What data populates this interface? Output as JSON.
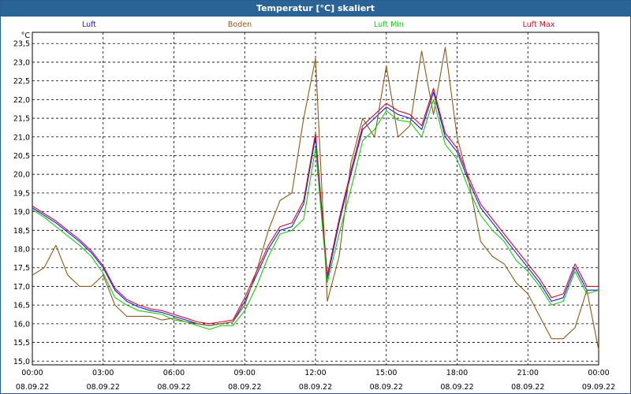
{
  "window": {
    "title": "Temperatur [°C] skaliert"
  },
  "chart_data": {
    "type": "line",
    "title": "Temperatur [°C] skaliert",
    "ylabel": "°C",
    "ylim": [
      14.9,
      23.8
    ],
    "xlim": [
      0,
      24
    ],
    "grid": true,
    "legend": "top",
    "yticks": [
      "23,5",
      "23,0",
      "22,5",
      "22,0",
      "21,5",
      "21,0",
      "20,5",
      "20,0",
      "19,5",
      "19,0",
      "18,5",
      "18,0",
      "17,5",
      "17,0",
      "16,5",
      "16,0",
      "15,5",
      "15,0"
    ],
    "xticks": [
      {
        "t": 0,
        "time": "00:00",
        "date": "08.09.22"
      },
      {
        "t": 3,
        "time": "03:00",
        "date": "08.09.22"
      },
      {
        "t": 6,
        "time": "06:00",
        "date": "08.09.22"
      },
      {
        "t": 9,
        "time": "09:00",
        "date": "08.09.22"
      },
      {
        "t": 12,
        "time": "12:00",
        "date": "08.09.22"
      },
      {
        "t": 15,
        "time": "15:00",
        "date": "08.09.22"
      },
      {
        "t": 18,
        "time": "18:00",
        "date": "08.09.22"
      },
      {
        "t": 21,
        "time": "21:00",
        "date": "08.09.22"
      },
      {
        "t": 24,
        "time": "00:00",
        "date": "09.09.22"
      }
    ],
    "series": [
      {
        "name": "Luft",
        "color": "#1a1adc",
        "x": [
          0,
          0.5,
          1,
          1.5,
          2,
          2.5,
          3,
          3.5,
          4,
          4.5,
          5,
          5.5,
          6,
          6.5,
          7,
          7.5,
          8,
          8.5,
          9,
          9.5,
          10,
          10.5,
          11,
          11.5,
          12,
          12.5,
          13,
          13.5,
          14,
          14.5,
          15,
          15.5,
          16,
          16.5,
          17,
          17.5,
          18,
          18.5,
          19,
          19.5,
          20,
          20.5,
          21,
          21.5,
          22,
          22.5,
          23,
          23.5,
          24
        ],
        "y": [
          19.1,
          18.9,
          18.7,
          18.45,
          18.2,
          17.9,
          17.5,
          16.9,
          16.6,
          16.45,
          16.35,
          16.3,
          16.2,
          16.1,
          16.0,
          15.95,
          16.0,
          16.05,
          16.6,
          17.3,
          18.0,
          18.5,
          18.6,
          19.2,
          21.0,
          17.2,
          18.7,
          20.0,
          21.2,
          21.5,
          21.8,
          21.6,
          21.5,
          21.2,
          22.2,
          21.0,
          20.6,
          19.8,
          19.1,
          18.7,
          18.3,
          17.9,
          17.5,
          17.1,
          16.6,
          16.7,
          17.5,
          16.9,
          16.9
        ]
      },
      {
        "name": "Boden",
        "color": "#8a5a1a",
        "x": [
          0,
          0.5,
          1,
          1.5,
          2,
          2.5,
          3,
          3.5,
          4,
          4.5,
          5,
          5.5,
          6,
          6.5,
          7,
          7.5,
          8,
          8.5,
          9,
          9.5,
          10,
          10.5,
          11,
          11.5,
          12,
          12.5,
          13,
          13.5,
          14,
          14.5,
          15,
          15.5,
          16,
          16.5,
          17,
          17.5,
          18,
          18.5,
          19,
          19.5,
          20,
          20.5,
          21,
          21.5,
          22,
          22.5,
          23,
          23.5,
          24
        ],
        "y": [
          17.3,
          17.5,
          18.1,
          17.3,
          17.0,
          17.0,
          17.3,
          16.5,
          16.2,
          16.2,
          16.2,
          16.1,
          16.15,
          16.05,
          16.0,
          15.95,
          16.0,
          16.05,
          16.5,
          17.4,
          18.5,
          19.3,
          19.5,
          21.5,
          23.1,
          16.6,
          17.8,
          20.3,
          21.5,
          21.0,
          22.9,
          21.0,
          21.3,
          23.3,
          21.6,
          23.4,
          21.0,
          19.8,
          18.2,
          17.8,
          17.6,
          17.1,
          16.8,
          16.2,
          15.6,
          15.6,
          15.9,
          16.9,
          15.3
        ]
      },
      {
        "name": "Luft Min",
        "color": "#18c818",
        "x": [
          0,
          0.5,
          1,
          1.5,
          2,
          2.5,
          3,
          3.5,
          4,
          4.5,
          5,
          5.5,
          6,
          6.5,
          7,
          7.5,
          8,
          8.5,
          9,
          9.5,
          10,
          10.5,
          11,
          11.5,
          12,
          12.5,
          13,
          13.5,
          14,
          14.5,
          15,
          15.5,
          16,
          16.5,
          17,
          17.5,
          18,
          18.5,
          19,
          19.5,
          20,
          20.5,
          21,
          21.5,
          22,
          22.5,
          23,
          23.5,
          24
        ],
        "y": [
          19.05,
          18.85,
          18.6,
          18.35,
          18.1,
          17.8,
          17.35,
          16.7,
          16.5,
          16.35,
          16.3,
          16.25,
          16.1,
          16.05,
          15.95,
          15.85,
          15.95,
          15.95,
          16.35,
          17.0,
          17.8,
          18.4,
          18.5,
          18.8,
          20.7,
          17.1,
          18.4,
          19.6,
          20.9,
          21.2,
          21.7,
          21.45,
          21.4,
          21.0,
          22.0,
          20.8,
          20.4,
          19.6,
          18.9,
          18.5,
          18.2,
          17.7,
          17.4,
          17.0,
          16.5,
          16.6,
          17.4,
          16.8,
          16.9
        ]
      },
      {
        "name": "Luft Max",
        "color": "#c8102e",
        "x": [
          0,
          0.5,
          1,
          1.5,
          2,
          2.5,
          3,
          3.5,
          4,
          4.5,
          5,
          5.5,
          6,
          6.5,
          7,
          7.5,
          8,
          8.5,
          9,
          9.5,
          10,
          10.5,
          11,
          11.5,
          12,
          12.5,
          13,
          13.5,
          14,
          14.5,
          15,
          15.5,
          16,
          16.5,
          17,
          17.5,
          18,
          18.5,
          19,
          19.5,
          20,
          20.5,
          21,
          21.5,
          22,
          22.5,
          23,
          23.5,
          24
        ],
        "y": [
          19.15,
          18.95,
          18.75,
          18.5,
          18.25,
          17.95,
          17.55,
          16.95,
          16.65,
          16.5,
          16.4,
          16.35,
          16.25,
          16.15,
          16.05,
          16.0,
          16.05,
          16.1,
          16.7,
          17.4,
          18.1,
          18.6,
          18.7,
          19.3,
          21.1,
          17.3,
          18.8,
          20.1,
          21.3,
          21.6,
          21.9,
          21.7,
          21.6,
          21.3,
          22.3,
          21.1,
          20.7,
          19.9,
          19.2,
          18.8,
          18.4,
          18.0,
          17.6,
          17.2,
          16.7,
          16.8,
          17.6,
          17.0,
          17.0
        ]
      }
    ]
  }
}
